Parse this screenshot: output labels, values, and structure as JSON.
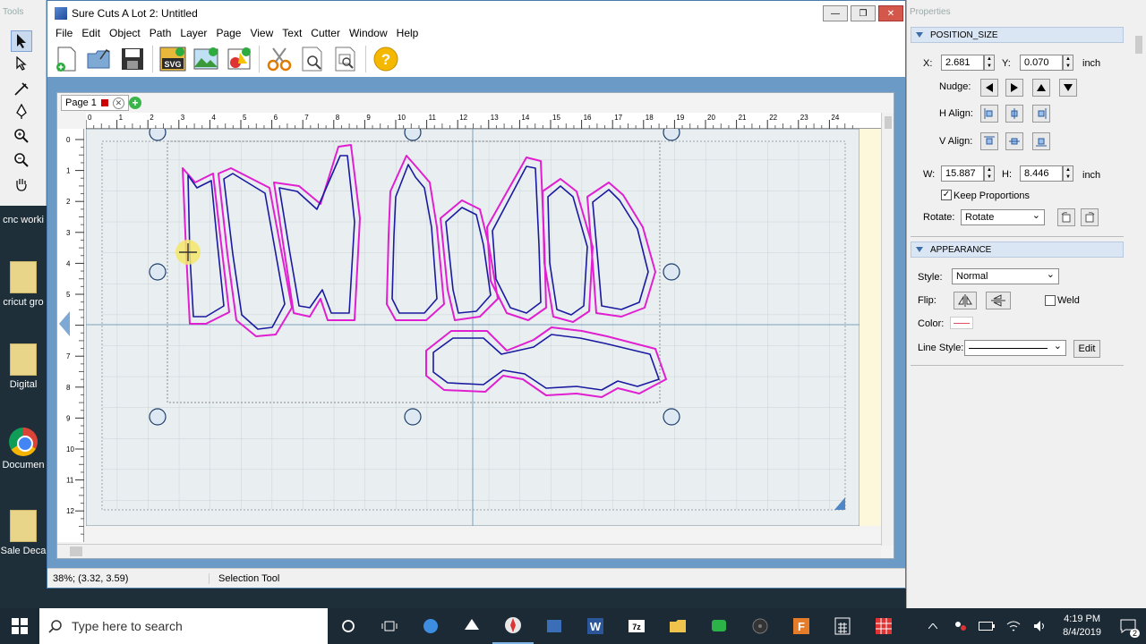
{
  "tools": {
    "title": "Tools",
    "items": [
      "select-arrow-icon",
      "node-edit-icon",
      "knife-icon",
      "pen-icon",
      "zoom-in-icon",
      "zoom-out-icon",
      "pan-hand-icon"
    ]
  },
  "desktop_icons": [
    {
      "label": "cnc worki"
    },
    {
      "label": "cricut gro"
    },
    {
      "label": "Digital"
    },
    {
      "label": "Documen"
    },
    {
      "label": "Sale Deca"
    }
  ],
  "window": {
    "title": "Sure Cuts A Lot 2: Untitled",
    "menus": [
      "File",
      "Edit",
      "Object",
      "Path",
      "Layer",
      "Page",
      "View",
      "Text",
      "Cutter",
      "Window",
      "Help"
    ]
  },
  "document": {
    "tab_label": "Page 1",
    "ruler_top": [
      "0",
      "1",
      "2",
      "3",
      "4",
      "5",
      "6",
      "7",
      "8",
      "9",
      "10",
      "11",
      "12",
      "13",
      "14",
      "15",
      "16",
      "17",
      "18",
      "19",
      "20",
      "21",
      "22",
      "23",
      "24"
    ],
    "ruler_left": [
      "0",
      "1",
      "2",
      "3",
      "4",
      "5",
      "6",
      "7",
      "8",
      "9",
      "10",
      "11",
      "12"
    ]
  },
  "status": {
    "coords": "38%; (3.32, 3.59)",
    "tool": "Selection Tool"
  },
  "properties": {
    "title": "Properties",
    "position_size": {
      "heading": "POSITION_SIZE",
      "x_label": "X:",
      "x_value": "2.681",
      "y_label": "Y:",
      "y_value": "0.070",
      "unit": "inch",
      "nudge_label": "Nudge:",
      "halign_label": "H Align:",
      "valign_label": "V Align:",
      "w_label": "W:",
      "w_value": "15.887",
      "h_label": "H:",
      "h_value": "8.446",
      "unit2": "inch",
      "keep_label": "Keep Proportions",
      "rotate_label": "Rotate:",
      "rotate_value": "Rotate"
    },
    "appearance": {
      "heading": "APPEARANCE",
      "style_label": "Style:",
      "style_value": "Normal",
      "flip_label": "Flip:",
      "weld_label": "Weld",
      "color_label": "Color:",
      "line_style_label": "Line Style:",
      "edit_label": "Edit"
    }
  },
  "taskbar": {
    "search_placeholder": "Type here to search",
    "time": "4:19 PM",
    "date": "8/4/2019",
    "notifications": "2"
  },
  "colors": {
    "outline_magenta": "#e020d0",
    "outline_blue": "#1a1aa0",
    "mat": "#e4ebee",
    "window_frame": "#6b9ac7"
  }
}
